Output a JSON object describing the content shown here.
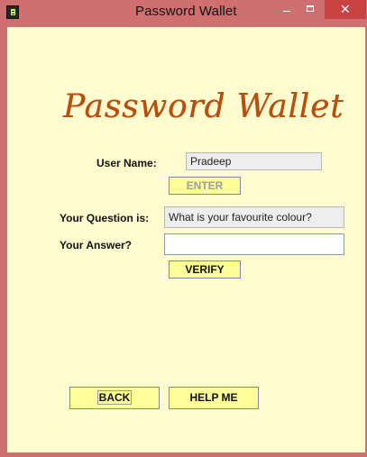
{
  "window": {
    "title": "Password Wallet"
  },
  "logo": {
    "text": "Password Wallet"
  },
  "form": {
    "user_name_label": "User Name:",
    "user_name_value": "Pradeep",
    "enter_label": "ENTER",
    "question_label": "Your Question is:",
    "question_value": "What is your favourite colour?",
    "answer_label": "Your Answer?",
    "answer_value": "",
    "verify_label": "VERIFY"
  },
  "footer": {
    "back_label": "BACK",
    "help_label": "HELP ME"
  },
  "icons": {
    "app": "wallet-app-icon",
    "minimize": "minimize-icon",
    "maximize": "maximize-icon",
    "close": "close-icon"
  },
  "colors": {
    "window_frame": "#cf6f6f",
    "content_background": "#fffdcf",
    "button_background": "#ffff99",
    "logo_text": "#b84f0f",
    "close_button": "#c84343"
  }
}
